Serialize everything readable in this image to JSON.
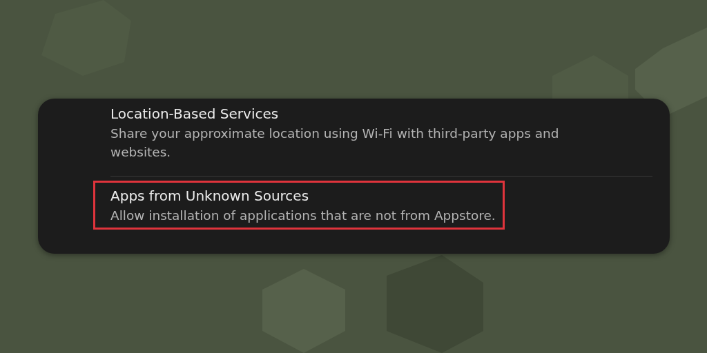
{
  "settings": [
    {
      "title": "Location-Based Services",
      "description": "Share your approximate location using Wi-Fi with third-party apps and websites.",
      "highlighted": false
    },
    {
      "title": "Apps from Unknown Sources",
      "description": "Allow installation of applications that are not from Appstore.",
      "highlighted": true
    }
  ]
}
